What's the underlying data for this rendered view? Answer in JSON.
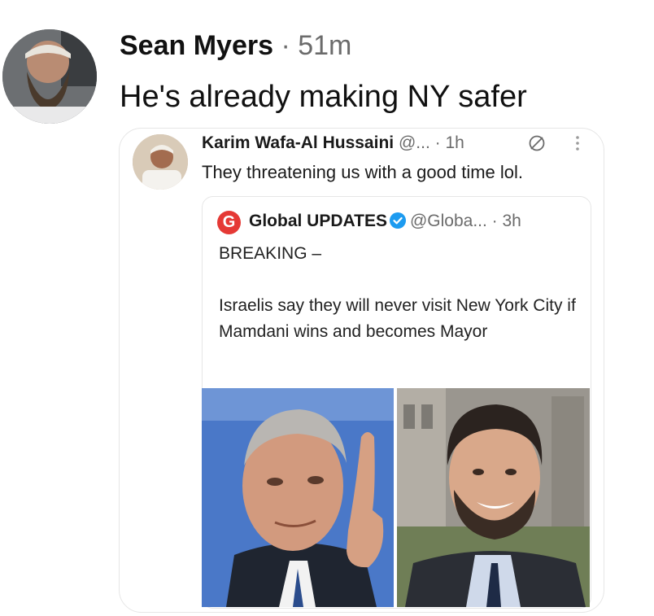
{
  "post": {
    "author": "Sean Myers",
    "separator": " · ",
    "time": "51m",
    "text": "He's already making NY safer"
  },
  "quoted_post": {
    "author": "Karim Wafa-Al Hussaini",
    "handle": "@...",
    "separator": " · ",
    "time": "1h",
    "text": "They threatening us with a good time lol.",
    "icons": [
      "edit-icon",
      "more-icon"
    ]
  },
  "embedded_post": {
    "logo_letter": "G",
    "author": "Global UPDATES",
    "handle": "@Globa...",
    "separator": " · ",
    "time": "3h",
    "text": "BREAKING –\n\nIsraelis say they will never visit New York City if Mamdani wins and becomes Mayor",
    "verified_icon": "verified-badge-icon",
    "colors": {
      "logo": "#e53935",
      "verified": "#1d9bf0"
    }
  }
}
